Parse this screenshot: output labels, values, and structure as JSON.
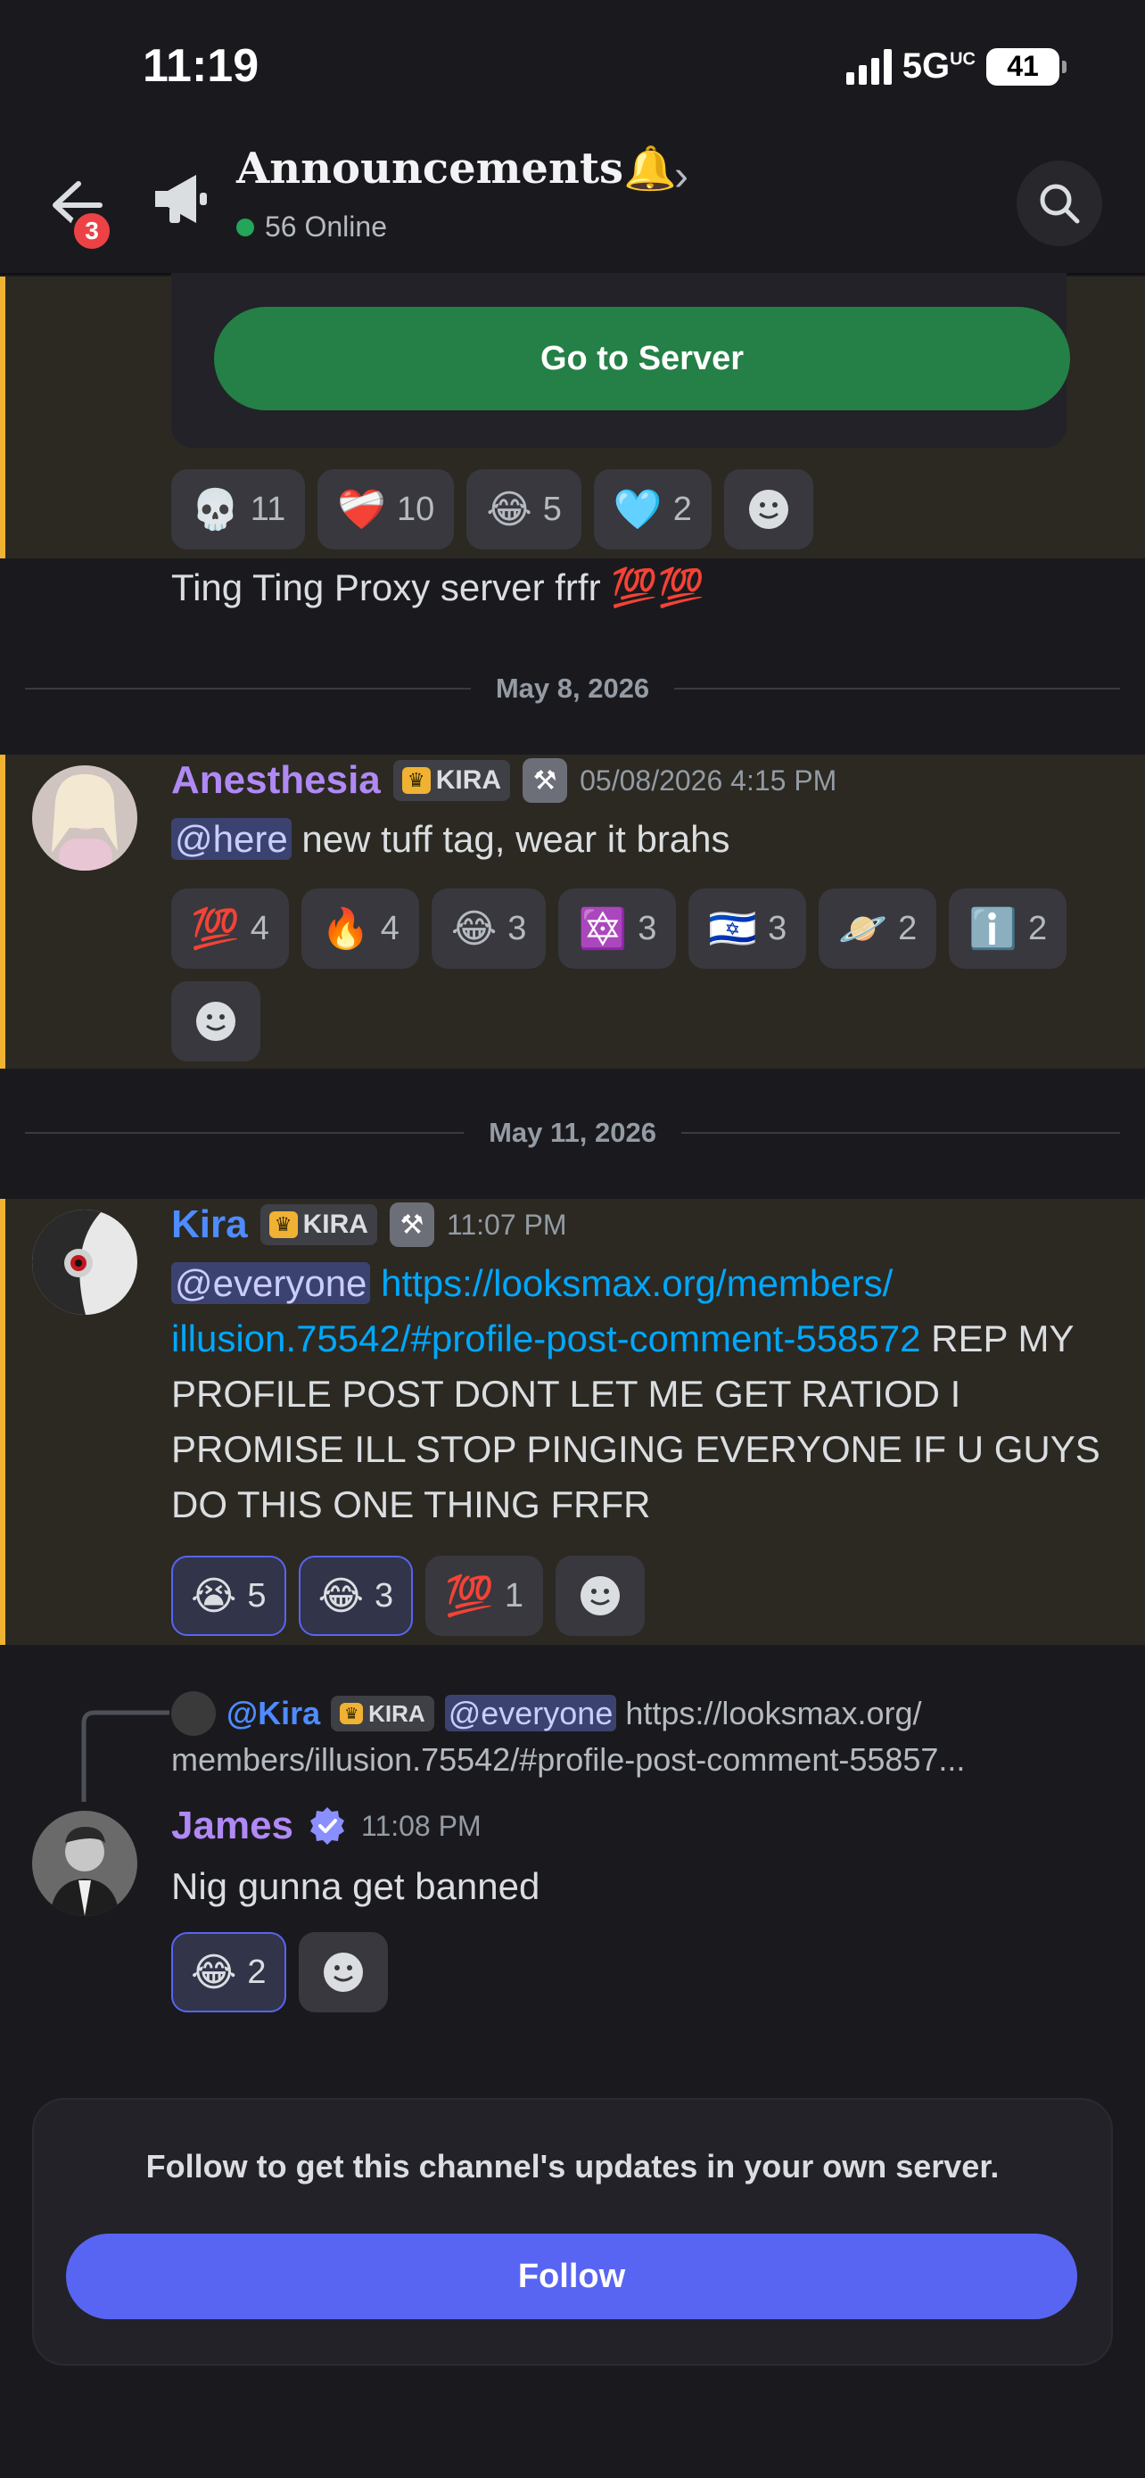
{
  "status_bar": {
    "time": "11:19",
    "network": "5G",
    "network_sup": "UC",
    "battery": "41"
  },
  "header": {
    "back_badge": "3",
    "channel_title": "Announcements🔔",
    "online_text": "56 Online"
  },
  "embed": {
    "button_label": "Go to Server"
  },
  "reactions_1": [
    {
      "emoji": "💀",
      "count": "11"
    },
    {
      "emoji": "❤️‍🩹",
      "count": "10"
    },
    {
      "emoji": "😂",
      "count": "5"
    },
    {
      "emoji": "🩵",
      "count": "2"
    }
  ],
  "message_0": {
    "text": "Ting Ting Proxy server frfr 💯💯"
  },
  "date_1": "May 8, 2026",
  "message_1": {
    "author": "Anesthesia",
    "tag": "KIRA",
    "timestamp": "05/08/2026 4:15 PM",
    "mention": "@here",
    "text": " new tuff tag, wear it brahs",
    "author_color": "#b089f5",
    "reactions": [
      {
        "emoji": "💯",
        "count": "4"
      },
      {
        "emoji": "🔥",
        "count": "4"
      },
      {
        "emoji": "😂",
        "count": "3"
      },
      {
        "emoji": "🔯",
        "count": "3"
      },
      {
        "emoji": "🇮🇱",
        "count": "3"
      },
      {
        "emoji": "🪐",
        "count": "2"
      },
      {
        "emoji": "ℹ️",
        "count": "2"
      }
    ]
  },
  "date_2": "May 11, 2026",
  "message_2": {
    "author": "Kira",
    "tag": "KIRA",
    "timestamp": "11:07 PM",
    "mention": "@everyone",
    "link": "https://looksmax.org/members/illusion.75542/#profile-post-comment-558572",
    "link_line1": "https://looksmax.org/members/",
    "link_line2": "illusion.75542/#profile-post-comment-558572",
    "text_after_link": " REP",
    "text_rest": "MY PROFILE POST DONT LET ME GET RATIOD I PROMISE ILL STOP PINGING EVERYONE IF U GUYS DO THIS ONE THING FRFR",
    "author_color": "#4e8cff",
    "reactions": [
      {
        "emoji": "😭",
        "count": "5",
        "me": true
      },
      {
        "emoji": "😂",
        "count": "3",
        "me": true
      },
      {
        "emoji": "💯",
        "count": "1",
        "me": false
      }
    ]
  },
  "message_3": {
    "reply_author": "@Kira",
    "reply_tag": "KIRA",
    "reply_mention": "@everyone",
    "reply_text_1": " https://looksmax.org/",
    "reply_text_2": "members/illusion.75542/#profile-post-comment-55857...",
    "author": "James",
    "timestamp": "11:08 PM",
    "text": "Nig gunna get banned",
    "author_color": "#b089f5",
    "reactions": [
      {
        "emoji": "😂",
        "count": "2",
        "me": true
      }
    ]
  },
  "follow_card": {
    "text": "Follow to get this channel's updates in your own server.",
    "button_label": "Follow"
  },
  "colors": {
    "accent": "#5865f2",
    "green": "#248046",
    "highlight_bar": "#f0b232",
    "link": "#00a8fc"
  }
}
